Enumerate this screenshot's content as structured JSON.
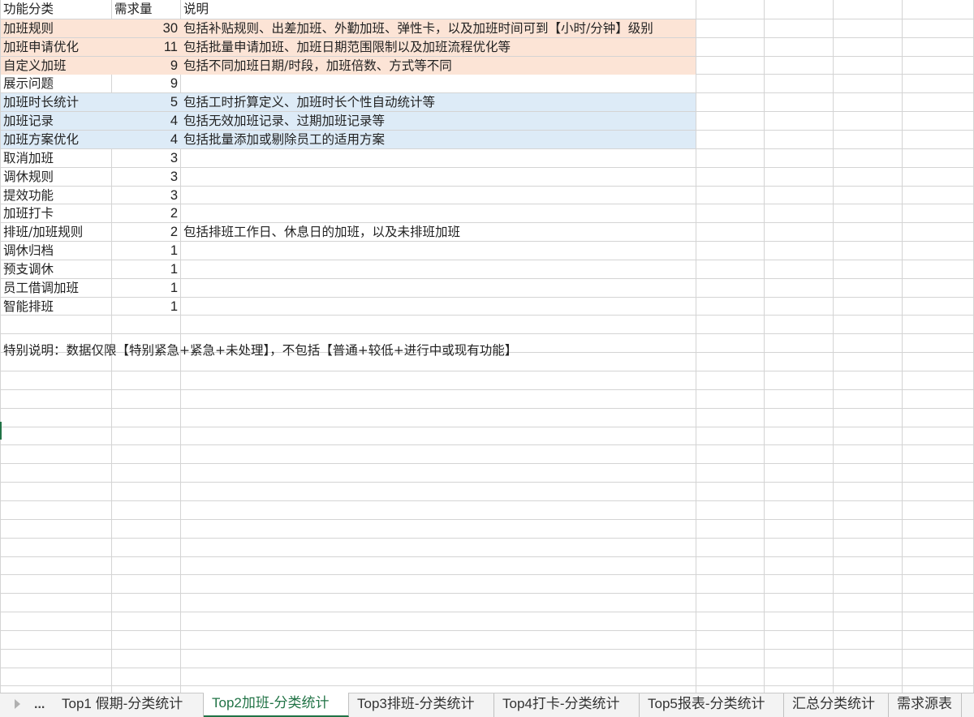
{
  "sheet": {
    "header": {
      "category": "功能分类",
      "count": "需求量",
      "note": "说明"
    },
    "rows": [
      {
        "category": "加班规则",
        "count": "30",
        "note": "包括补贴规则、出差加班、外勤加班、弹性卡，以及加班时间可到【小时/分钟】级别",
        "highlight": "orange"
      },
      {
        "category": "加班申请优化",
        "count": "11",
        "note": "包括批量申请加班、加班日期范围限制以及加班流程优化等",
        "highlight": "orange"
      },
      {
        "category": "自定义加班",
        "count": "9",
        "note": "包括不同加班日期/时段，加班倍数、方式等不同",
        "highlight": "orange"
      },
      {
        "category": "展示问题",
        "count": "9",
        "note": "",
        "highlight": "none"
      },
      {
        "category": "加班时长统计",
        "count": "5",
        "note": "包括工时折算定义、加班时长个性自动统计等",
        "highlight": "blue"
      },
      {
        "category": "加班记录",
        "count": "4",
        "note": "包括无效加班记录、过期加班记录等",
        "highlight": "blue"
      },
      {
        "category": "加班方案优化",
        "count": "4",
        "note": "包括批量添加或剔除员工的适用方案",
        "highlight": "blue"
      },
      {
        "category": "取消加班",
        "count": "3",
        "note": "",
        "highlight": "none"
      },
      {
        "category": "调休规则",
        "count": "3",
        "note": "",
        "highlight": "none"
      },
      {
        "category": "提效功能",
        "count": "3",
        "note": "",
        "highlight": "none"
      },
      {
        "category": "加班打卡",
        "count": "2",
        "note": "",
        "highlight": "none"
      },
      {
        "category": "排班/加班规则",
        "count": "2",
        "note": "包括排班工作日、休息日的加班，以及未排班加班",
        "highlight": "none"
      },
      {
        "category": "调休归档",
        "count": "1",
        "note": "",
        "highlight": "none"
      },
      {
        "category": "预支调休",
        "count": "1",
        "note": "",
        "highlight": "none"
      },
      {
        "category": "员工借调加班",
        "count": "1",
        "note": "",
        "highlight": "none"
      },
      {
        "category": "智能排班",
        "count": "1",
        "note": "",
        "highlight": "none"
      }
    ],
    "footnote": "特别说明：数据仅限【特别紧急+紧急+未处理】，不包括【普通+较低+进行中或现有功能】"
  },
  "colors": {
    "orange_fill": "#fce4d6",
    "blue_fill": "#ddebf7",
    "accent": "#217346",
    "grid": "#d4d4d4"
  },
  "tabs": {
    "more": "...",
    "items": [
      {
        "label": "Top1 假期-分类统计",
        "active": false
      },
      {
        "label": "Top2加班-分类统计",
        "active": true
      },
      {
        "label": "Top3排班-分类统计",
        "active": false
      },
      {
        "label": "Top4打卡-分类统计",
        "active": false
      },
      {
        "label": "Top5报表-分类统计",
        "active": false
      },
      {
        "label": "汇总分类统计",
        "active": false
      },
      {
        "label": "需求源表",
        "active": false
      }
    ]
  }
}
